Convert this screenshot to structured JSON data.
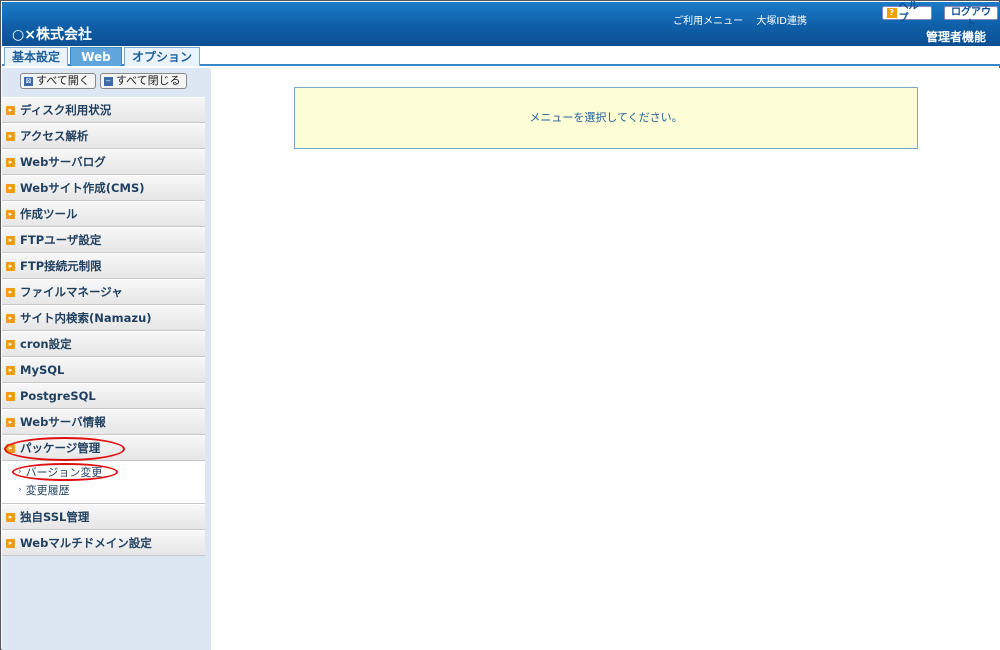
{
  "header": {
    "company": "○×株式会社",
    "links": [
      "ご利用メニュー",
      "大塚ID連携"
    ],
    "help_label": "ヘルプ",
    "logout_label": "ログアウト",
    "admin_label": "管理者機能"
  },
  "tabs": [
    {
      "label": "基本設定"
    },
    {
      "label": "Web"
    },
    {
      "label": "オプション"
    }
  ],
  "sidebar": {
    "expand_all": "すべて開く",
    "collapse_all": "すべて閉じる",
    "items": [
      {
        "label": "ディスク利用状況"
      },
      {
        "label": "アクセス解析"
      },
      {
        "label": "Webサーバログ"
      },
      {
        "label": "Webサイト作成(CMS)"
      },
      {
        "label": "作成ツール"
      },
      {
        "label": "FTPユーザ設定"
      },
      {
        "label": "FTP接続元制限"
      },
      {
        "label": "ファイルマネージャ"
      },
      {
        "label": "サイト内検索(Namazu)"
      },
      {
        "label": "cron設定"
      },
      {
        "label": "MySQL"
      },
      {
        "label": "PostgreSQL"
      },
      {
        "label": "Webサーバ情報"
      },
      {
        "label": "パッケージ管理"
      },
      {
        "label": "独自SSL管理"
      },
      {
        "label": "Webマルチドメイン設定"
      }
    ],
    "sub_items": [
      {
        "label": "バージョン変更"
      },
      {
        "label": "変更履歴"
      }
    ]
  },
  "main": {
    "notice": "メニューを選択してください。"
  }
}
